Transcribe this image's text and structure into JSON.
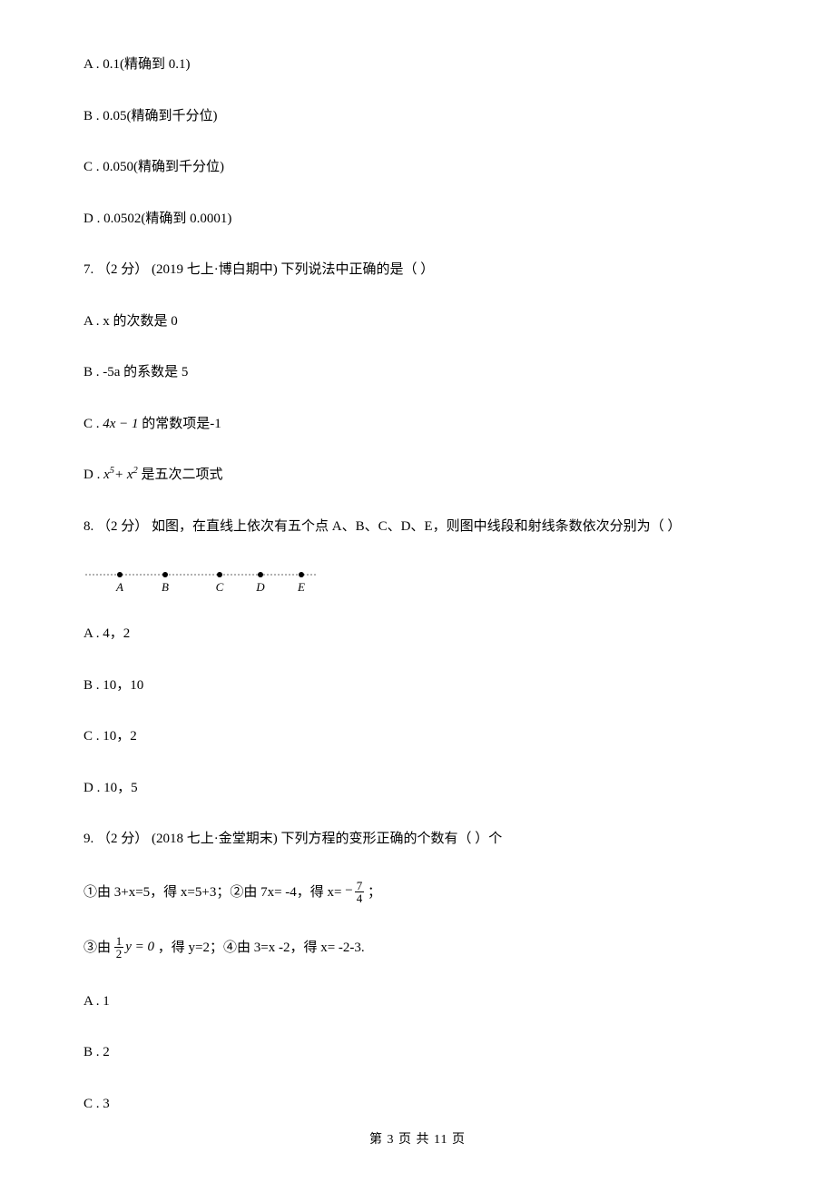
{
  "q6_choices": {
    "A": "A . 0.1(精确到 0.1)",
    "B": "B . 0.05(精确到千分位)",
    "C": "C . 0.050(精确到千分位)",
    "D": "D . 0.0502(精确到 0.0001)"
  },
  "q7": {
    "stem": "7. （2 分） (2019 七上·博白期中) 下列说法中正确的是（    ）",
    "A": "A . x 的次数是 0",
    "B": "B . -5a 的系数是 5",
    "C_pre": "C . ",
    "C_expr": "4x − 1",
    "C_post": " 的常数项是-1",
    "D_pre": "D . ",
    "D_post": " 是五次二项式"
  },
  "q8": {
    "stem": "8. （2 分） 如图，在直线上依次有五个点 A、B、C、D、E，则图中线段和射线条数依次分别为（    ）",
    "A": "A . 4，2",
    "B": "B . 10，10",
    "C": "C . 10，2",
    "D": "D . 10，5"
  },
  "q9": {
    "stem": "9. （2 分） (2018 七上·金堂期末) 下列方程的变形正确的个数有（    ）个",
    "line1_pre": "①由 3+x=5，得 x=5+3；②由 7x= -4，得 x=",
    "line1_post": " ；",
    "line2_pre": "③由 ",
    "line2_mid": "y = 0",
    "line2_post": " ，得 y=2；④由 3=x -2，得 x= -2-3.",
    "A": "A . 1",
    "B": "B . 2",
    "C": "C . 3"
  },
  "footer": "第 3 页 共 11 页",
  "diagram_labels": {
    "A": "A",
    "B": "B",
    "C": "C",
    "D": "D",
    "E": "E"
  },
  "frac_neg74": {
    "num": "7",
    "den": "4"
  },
  "frac_half": {
    "num": "1",
    "den": "2"
  },
  "d_exponents": {
    "e1": "5",
    "e2": "2"
  }
}
